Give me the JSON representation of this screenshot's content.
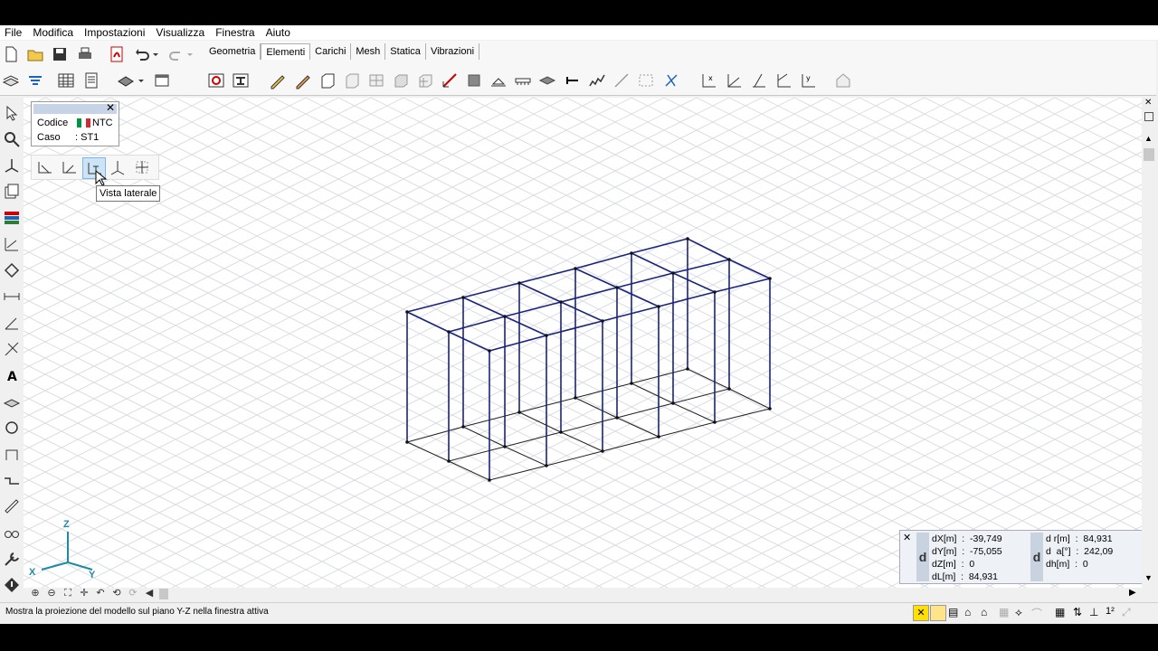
{
  "menu": [
    "File",
    "Modifica",
    "Impostazioni",
    "Visualizza",
    "Finestra",
    "Aiuto"
  ],
  "tabs": [
    {
      "label": "Geometria",
      "active": false
    },
    {
      "label": "Elementi",
      "active": true
    },
    {
      "label": "Carichi",
      "active": false
    },
    {
      "label": "Mesh",
      "active": false
    },
    {
      "label": "Statica",
      "active": false
    },
    {
      "label": "Vibrazioni",
      "active": false
    }
  ],
  "infobox": {
    "codice_label": "Codice",
    "codice_value": "NTC",
    "caso_label": "Caso",
    "caso_value": ": ST1"
  },
  "view_buttons": [
    {
      "name": "view-xz-icon",
      "label": "X"
    },
    {
      "name": "view-yz-icon",
      "label": "Y"
    },
    {
      "name": "view-side-icon",
      "label": "Z"
    },
    {
      "name": "view-axono-icon",
      "label": ""
    },
    {
      "name": "view-plan-icon",
      "label": ""
    }
  ],
  "tooltip": "Vista laterale",
  "measure": {
    "dx": "dX[m]  :  -39,749",
    "dy": "dY[m]  :  -75,055",
    "dz": "dZ[m]  :  0",
    "dl": "dL[m]  :  84,931",
    "dr": "d r[m]  :  84,931",
    "da": "d  a[°]  :  242,09",
    "dh": "dh[m]  :  0",
    "icon_letter": "d"
  },
  "axes": {
    "x": "X",
    "y": "Y",
    "z": "Z"
  },
  "status": "Mostra la proiezione del modello sul piano Y-Z nella finestra attiva",
  "colors": {
    "frame": "#1a237e",
    "grid": "#d4d8df",
    "accent": "#ffe000"
  }
}
